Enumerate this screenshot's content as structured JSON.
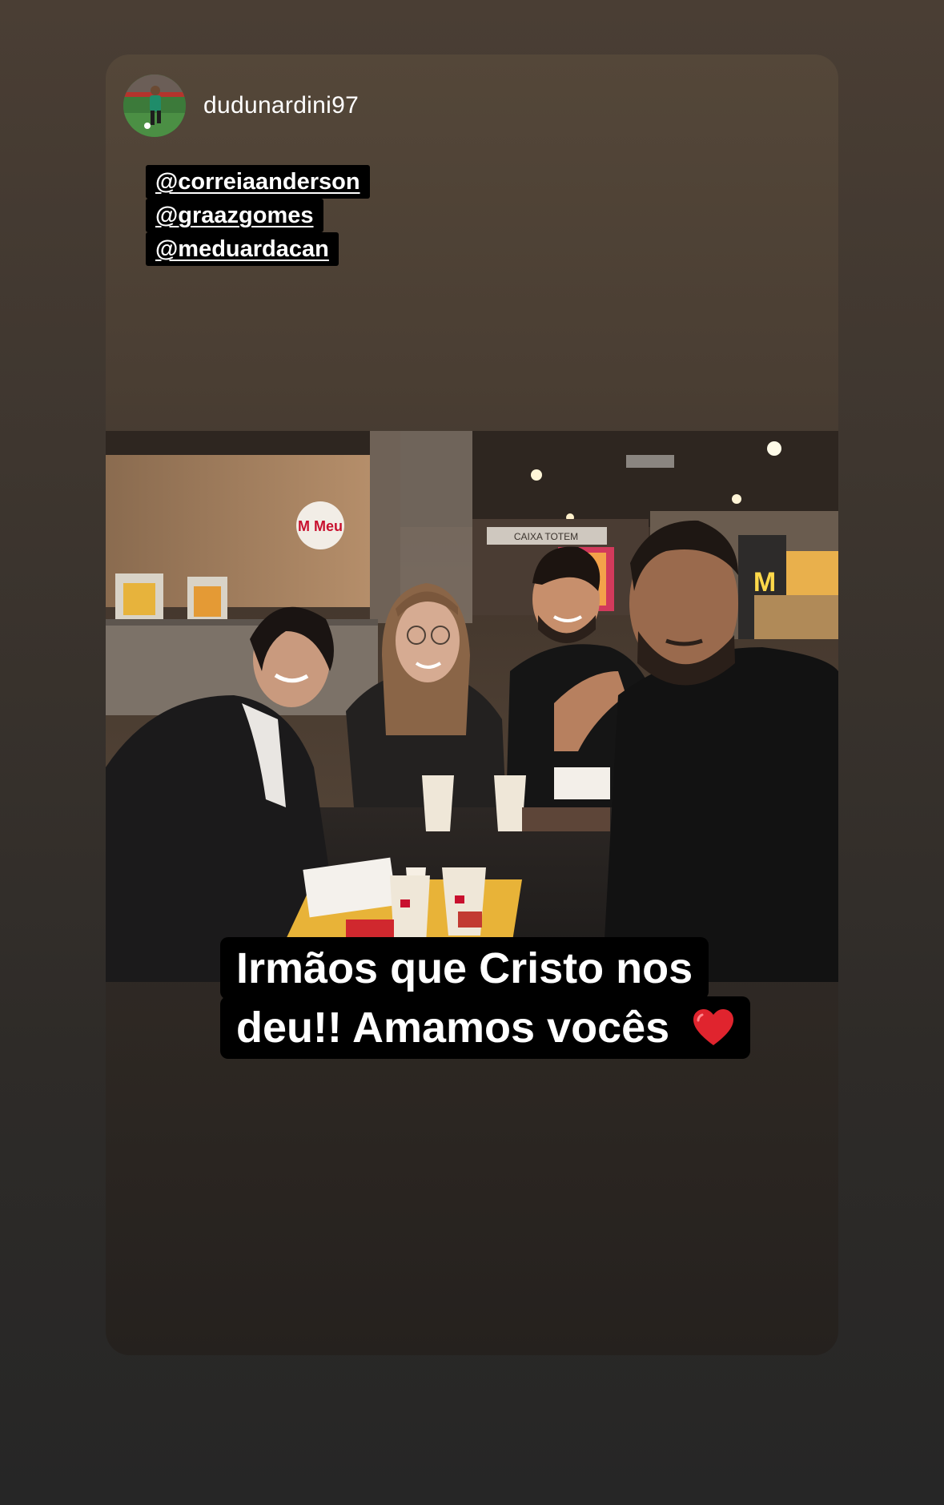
{
  "story": {
    "username": "dudunardini97",
    "mentions": [
      "@correiaanderson",
      "@graazgomes",
      "@meduardacan"
    ],
    "caption_lines": [
      "Irmãos que Cristo nos",
      "deu!! Amamos vocês"
    ],
    "caption_emoji": "red-heart-icon",
    "photo": {
      "signage": {
        "meu_logo": "M Meu",
        "counter_sign": "CAIXA TOTEM",
        "brand_arches": "M"
      }
    }
  },
  "colors": {
    "tag_background": "#000000",
    "tag_text": "#ffffff",
    "heart": "#e0242e"
  }
}
